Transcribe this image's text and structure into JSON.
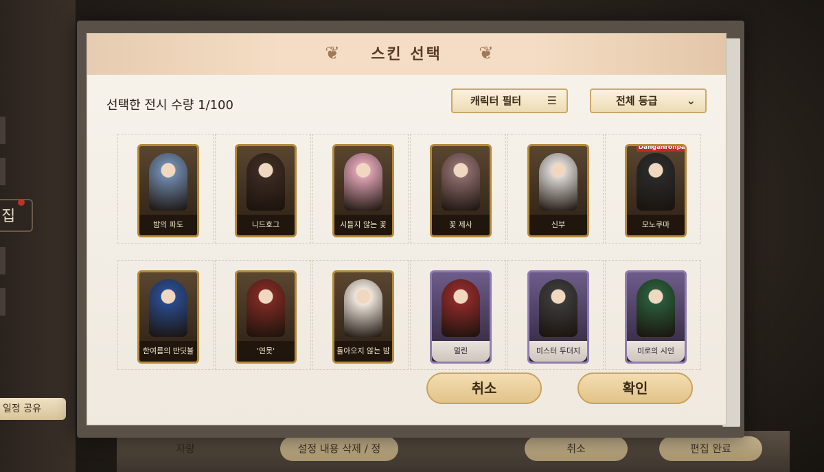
{
  "dialog": {
    "title": "스킨 선택",
    "count_label": "선택한 전시 수량 1/100",
    "filter_button": "캐릭터 필터",
    "grade_dropdown": "전체 등급",
    "cancel_button": "취소",
    "confirm_button": "확인"
  },
  "skins": [
    {
      "name": "밤의 파도",
      "frame": "gold",
      "tint": "#6d86a8"
    },
    {
      "name": "니드호그",
      "frame": "gold",
      "tint": "#3a2a22"
    },
    {
      "name": "시들지 않는 꽃",
      "frame": "gold",
      "tint": "#d9a0b0"
    },
    {
      "name": "꽃 제사",
      "frame": "gold",
      "tint": "#8a6a6a"
    },
    {
      "name": "신부",
      "frame": "gold",
      "tint": "#d8d4d0"
    },
    {
      "name": "모노쿠마",
      "frame": "gold",
      "tint": "#2a2a2a",
      "badge": "Danganronpa"
    },
    {
      "name": "한여름의 반딧불",
      "frame": "gold",
      "tint": "#2a4a8a"
    },
    {
      "name": "'연못'",
      "frame": "gold",
      "tint": "#7a2a22"
    },
    {
      "name": "돌아오지 않는 밤",
      "frame": "gold",
      "tint": "#efe6dc"
    },
    {
      "name": "멀린",
      "frame": "purple",
      "tint": "#8a2a2a"
    },
    {
      "name": "미스터 두더지",
      "frame": "purple",
      "tint": "#3a3a3a"
    },
    {
      "name": "미로의 시인",
      "frame": "purple",
      "tint": "#2a5a3a"
    }
  ],
  "background": {
    "left_edit_label": "집",
    "left_share_label": "일정 공유",
    "bottom_items": [
      "자랑",
      "설정 내용 삭제 / 정",
      "취소",
      "편집 완료"
    ]
  }
}
